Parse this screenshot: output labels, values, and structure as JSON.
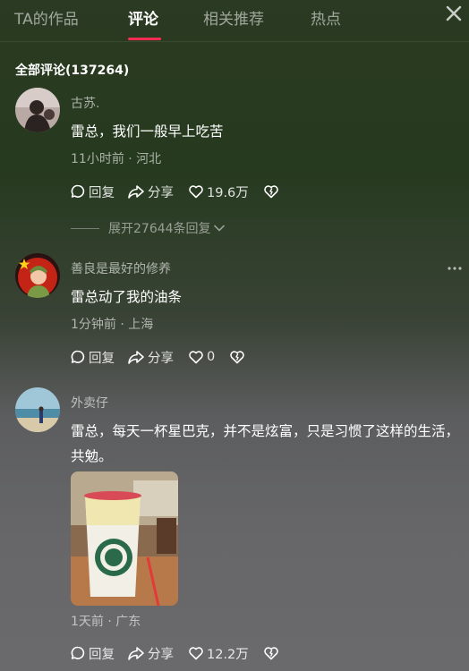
{
  "tabs": [
    {
      "label": "TA的作品"
    },
    {
      "label": "评论"
    },
    {
      "label": "相关推荐"
    },
    {
      "label": "热点"
    }
  ],
  "comments_header": {
    "title": "全部评论(137264)"
  },
  "comments": [
    {
      "user": "古苏.",
      "text": "雷总，我们一般早上吃苦",
      "meta": "11小时前 · 河北",
      "actions": {
        "reply": "回复",
        "share": "分享",
        "likes": "19.6万"
      },
      "expand_replies": "展开27644条回复"
    },
    {
      "user": "善良是最好的修养",
      "text": "雷总动了我的油条",
      "meta": "1分钟前 · 上海",
      "actions": {
        "reply": "回复",
        "share": "分享",
        "likes": "0"
      }
    },
    {
      "user": "外卖仔",
      "text": "雷总，每天一杯星巴克，并不是炫富，只是习惯了这样的生活，共勉。",
      "meta": "1天前 · 广东",
      "actions": {
        "reply": "回复",
        "share": "分享",
        "likes": "12.2万"
      }
    }
  ],
  "colors": {
    "accent": "#fe2c55"
  }
}
